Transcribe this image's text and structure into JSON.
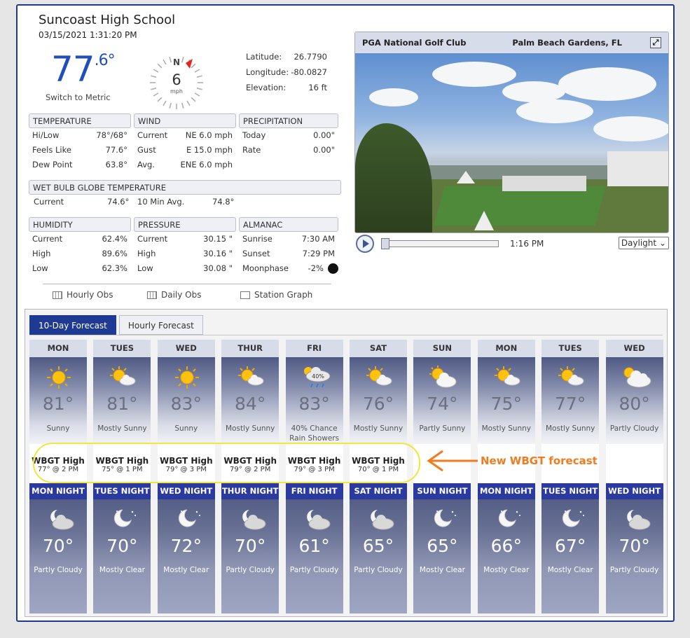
{
  "station": {
    "name": "Suncoast High School",
    "datetime": "03/15/2021 1:31:20 PM"
  },
  "current": {
    "temp_int": "77",
    "temp_dec": ".6°",
    "metric_link": "Switch to Metric",
    "wind_speed": "6",
    "wind_unit": "mph",
    "wind_dir": "N"
  },
  "coords": [
    {
      "label": "Latitude:",
      "value": "26.7790"
    },
    {
      "label": "Longitude:",
      "value": "-80.0827"
    },
    {
      "label": "Elevation:",
      "value": "16 ft"
    }
  ],
  "temperature": {
    "title": "TEMPERATURE",
    "rows": [
      {
        "k": "Hi/Low",
        "v": "78°/68°"
      },
      {
        "k": "Feels Like",
        "v": "77.6°"
      },
      {
        "k": "Dew Point",
        "v": "63.8°"
      }
    ]
  },
  "wind": {
    "title": "WIND",
    "rows": [
      {
        "k": "Current",
        "v": "NE 6.0 mph"
      },
      {
        "k": "Gust",
        "v": "E 15.0 mph"
      },
      {
        "k": "Avg.",
        "v": "ENE 6.0 mph"
      }
    ]
  },
  "precip": {
    "title": "PRECIPITATION",
    "rows": [
      {
        "k": "Today",
        "v": "0.00\""
      },
      {
        "k": "Rate",
        "v": "0.00\""
      }
    ]
  },
  "wbgt_now": {
    "title": "WET BULB GLOBE TEMPERATURE",
    "current_label": "Current",
    "current": "74.6°",
    "avg_label": "10 Min Avg.",
    "avg": "74.8°"
  },
  "humidity": {
    "title": "HUMIDITY",
    "rows": [
      {
        "k": "Current",
        "v": "62.4%"
      },
      {
        "k": "High",
        "v": "89.6%"
      },
      {
        "k": "Low",
        "v": "62.3%"
      }
    ]
  },
  "pressure": {
    "title": "PRESSURE",
    "rows": [
      {
        "k": "Current",
        "v": "30.15 \""
      },
      {
        "k": "High",
        "v": "30.16 \""
      },
      {
        "k": "Low",
        "v": "30.08 \""
      }
    ]
  },
  "almanac": {
    "title": "ALMANAC",
    "rows": [
      {
        "k": "Sunrise",
        "v": "7:30 AM"
      },
      {
        "k": "Sunset",
        "v": "7:29 PM"
      },
      {
        "k": "Moonphase",
        "v": "-2%"
      }
    ]
  },
  "links": {
    "hourly": "Hourly Obs",
    "daily": "Daily Obs",
    "graph": "Station Graph"
  },
  "camera": {
    "name": "PGA National Golf Club",
    "location": "Palm Beach Gardens, FL",
    "time": "1:16 PM",
    "mode": "Daylight"
  },
  "forecast": {
    "tabs": [
      "10-Day Forecast",
      "Hourly Forecast"
    ],
    "days": [
      {
        "name": "MON",
        "icon": "sunny-icon",
        "temp": "81°",
        "cond": "Sunny",
        "wbgt": "WBGT High",
        "wbgt_val": "77° @ 2 PM",
        "night": "MON NIGHT",
        "night_icon": "cloudy-night-icon",
        "ntemp": "70°",
        "ncond": "Partly Cloudy"
      },
      {
        "name": "TUES",
        "icon": "mostly-sunny-icon",
        "temp": "81°",
        "cond": "Mostly Sunny",
        "wbgt": "WBGT High",
        "wbgt_val": "75° @ 1 PM",
        "night": "TUES NIGHT",
        "night_icon": "clear-night-icon",
        "ntemp": "70°",
        "ncond": "Mostly Clear"
      },
      {
        "name": "WED",
        "icon": "sunny-icon",
        "temp": "83°",
        "cond": "Sunny",
        "wbgt": "WBGT High",
        "wbgt_val": "79° @ 3 PM",
        "night": "WED NIGHT",
        "night_icon": "clear-night-icon",
        "ntemp": "72°",
        "ncond": "Mostly Clear"
      },
      {
        "name": "THUR",
        "icon": "mostly-sunny-icon",
        "temp": "84°",
        "cond": "Mostly Sunny",
        "wbgt": "WBGT High",
        "wbgt_val": "79° @ 2 PM",
        "night": "THUR NIGHT",
        "night_icon": "cloudy-night-icon",
        "ntemp": "70°",
        "ncond": "Partly Cloudy"
      },
      {
        "name": "FRI",
        "icon": "rain-icon",
        "temp": "83°",
        "cond": "40% Chance Rain Showers",
        "wbgt": "WBGT High",
        "wbgt_val": "79° @ 3 PM",
        "night": "FRI NIGHT",
        "night_icon": "cloudy-night-icon",
        "ntemp": "61°",
        "ncond": "Partly Cloudy"
      },
      {
        "name": "SAT",
        "icon": "mostly-sunny-icon",
        "temp": "76°",
        "cond": "Mostly Sunny",
        "wbgt": "WBGT High",
        "wbgt_val": "70° @ 1 PM",
        "night": "SAT NIGHT",
        "night_icon": "cloudy-night-icon",
        "ntemp": "65°",
        "ncond": "Partly Cloudy"
      },
      {
        "name": "SUN",
        "icon": "partly-sunny-icon",
        "temp": "74°",
        "cond": "Partly Sunny",
        "wbgt": "",
        "wbgt_val": "",
        "night": "SUN NIGHT",
        "night_icon": "clear-night-icon",
        "ntemp": "65°",
        "ncond": "Mostly Clear"
      },
      {
        "name": "MON",
        "icon": "mostly-sunny-icon",
        "temp": "75°",
        "cond": "Mostly Sunny",
        "wbgt": "",
        "wbgt_val": "",
        "night": "MON NIGHT",
        "night_icon": "clear-night-icon",
        "ntemp": "66°",
        "ncond": "Mostly Clear"
      },
      {
        "name": "TUES",
        "icon": "mostly-sunny-icon",
        "temp": "77°",
        "cond": "Mostly Sunny",
        "wbgt": "",
        "wbgt_val": "",
        "night": "TUES NIGHT",
        "night_icon": "clear-night-icon",
        "ntemp": "67°",
        "ncond": "Mostly Clear"
      },
      {
        "name": "WED",
        "icon": "partly-cloudy-icon",
        "temp": "80°",
        "cond": "Partly Cloudy",
        "wbgt": "",
        "wbgt_val": "",
        "night": "WED NIGHT",
        "night_icon": "cloudy-night-icon",
        "ntemp": "70°",
        "ncond": "Partly Cloudy"
      }
    ],
    "rain_chance": "40%"
  },
  "annotation": "New WBGT forecast",
  "colors": {
    "accent": "#1f4fb8",
    "nav": "#1f3a93",
    "highlight": "#f1e63a",
    "arrow": "#f07c1e"
  }
}
